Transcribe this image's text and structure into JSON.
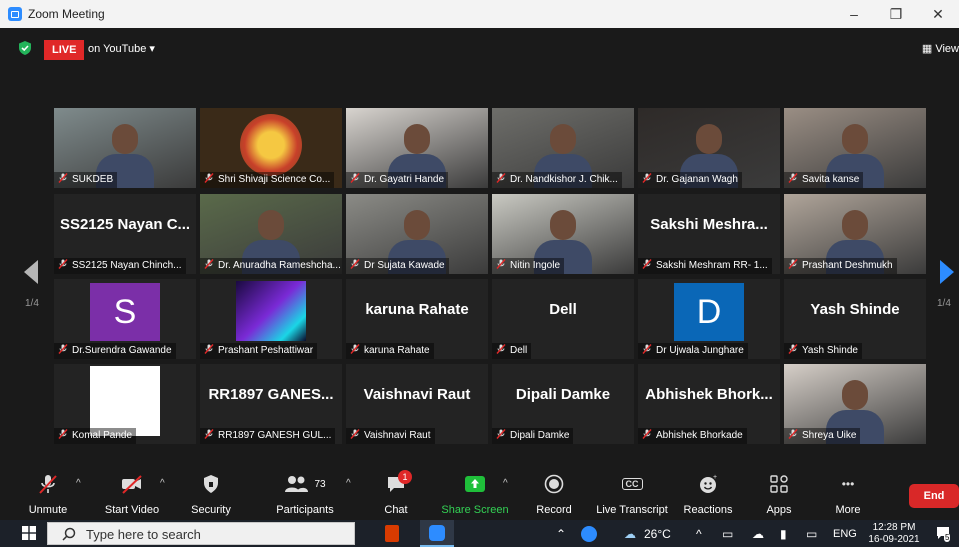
{
  "window": {
    "title": "Zoom Meeting",
    "minimize": "–",
    "restore": "❐",
    "close": "✕"
  },
  "topbar": {
    "live": "LIVE",
    "stream_target": "on YouTube ▾",
    "view": "View"
  },
  "page": {
    "left": "1/4",
    "right": "1/4"
  },
  "participants": [
    {
      "caption": "SUKDEB",
      "big": "",
      "kind": "video",
      "color": "#7f8b8c"
    },
    {
      "caption": "Shri Shivaji Science Co...",
      "big": "",
      "kind": "logo",
      "color": "#3a2a18"
    },
    {
      "caption": "Dr. Gayatri Hande",
      "big": "",
      "kind": "poster",
      "color": "#d8d4cf"
    },
    {
      "caption": "Dr. Nandkishor J. Chik...",
      "big": "",
      "kind": "video",
      "color": "#6e6e6a"
    },
    {
      "caption": "Dr. Gajanan Wagh",
      "big": "",
      "kind": "video",
      "color": "#2e2a28"
    },
    {
      "caption": "Savita kanse",
      "big": "",
      "kind": "video",
      "color": "#9a8e84"
    },
    {
      "caption": "SS2125 Nayan Chinch...",
      "big": "SS2125 Nayan C...",
      "kind": "name",
      "color": "#232323"
    },
    {
      "caption": "Dr. Anuradha Rameshcha...",
      "big": "",
      "kind": "video",
      "color": "#5a6a4a"
    },
    {
      "caption": "Dr Sujata Kawade",
      "big": "",
      "kind": "video",
      "color": "#8b8b86"
    },
    {
      "caption": "Nitin Ingole",
      "big": "",
      "kind": "video",
      "color": "#c9c9c2"
    },
    {
      "caption": "Sakshi Meshram RR- 1...",
      "big": "Sakshi  Meshra...",
      "kind": "name",
      "color": "#232323"
    },
    {
      "caption": "Prashant Deshmukh",
      "big": "",
      "kind": "video",
      "color": "#b0a59a"
    },
    {
      "caption": "Dr.Surendra Gawande",
      "big": "",
      "kind": "avatar",
      "letter": "S",
      "color": "#7b2fa8"
    },
    {
      "caption": "Prashant Peshattiwar",
      "big": "",
      "kind": "image",
      "color": "#3a1a6e"
    },
    {
      "caption": "karuna Rahate",
      "big": "karuna Rahate",
      "kind": "name",
      "color": "#232323"
    },
    {
      "caption": "Dell",
      "big": "Dell",
      "kind": "name",
      "color": "#232323"
    },
    {
      "caption": "Dr Ujwala Junghare",
      "big": "",
      "kind": "avatar",
      "letter": "D",
      "color": "#0a67b7"
    },
    {
      "caption": "Yash Shinde",
      "big": "Yash Shinde",
      "kind": "name",
      "color": "#232323"
    },
    {
      "caption": "Komal Pande",
      "big": "",
      "kind": "white",
      "color": "#ffffff"
    },
    {
      "caption": "RR1897  GANESH GUL...",
      "big": "RR1897   GANES...",
      "kind": "name",
      "color": "#232323"
    },
    {
      "caption": "Vaishnavi Raut",
      "big": "Vaishnavi Raut",
      "kind": "name",
      "color": "#232323"
    },
    {
      "caption": "Dipali Damke",
      "big": "Dipali Damke",
      "kind": "name",
      "color": "#232323"
    },
    {
      "caption": "Abhishek Bhorkade",
      "big": "Abhishek  Bhork...",
      "kind": "name",
      "color": "#232323"
    },
    {
      "caption": "Shreya Uike",
      "big": "",
      "kind": "video",
      "color": "#d6cfc8"
    }
  ],
  "controls": {
    "unmute": "Unmute",
    "start_video": "Start Video",
    "security": "Security",
    "participants": "Participants",
    "participants_count": "73",
    "chat": "Chat",
    "chat_badge": "1",
    "share_screen": "Share Screen",
    "record": "Record",
    "live_transcript": "Live Transcript",
    "cc": "CC",
    "reactions": "Reactions",
    "apps": "Apps",
    "more": "More",
    "more_dots": "•••",
    "end": "End"
  },
  "taskbar": {
    "search_placeholder": "Type here to search",
    "temperature": "26°C",
    "language": "ENG",
    "time": "12:28 PM",
    "date": "16-09-2021",
    "notif_count": "5"
  },
  "colors": {
    "accent": "#2d8cff",
    "end": "#d92828",
    "live": "#e02828",
    "share": "#1fbf3a",
    "highlight": "#c9e63b"
  }
}
